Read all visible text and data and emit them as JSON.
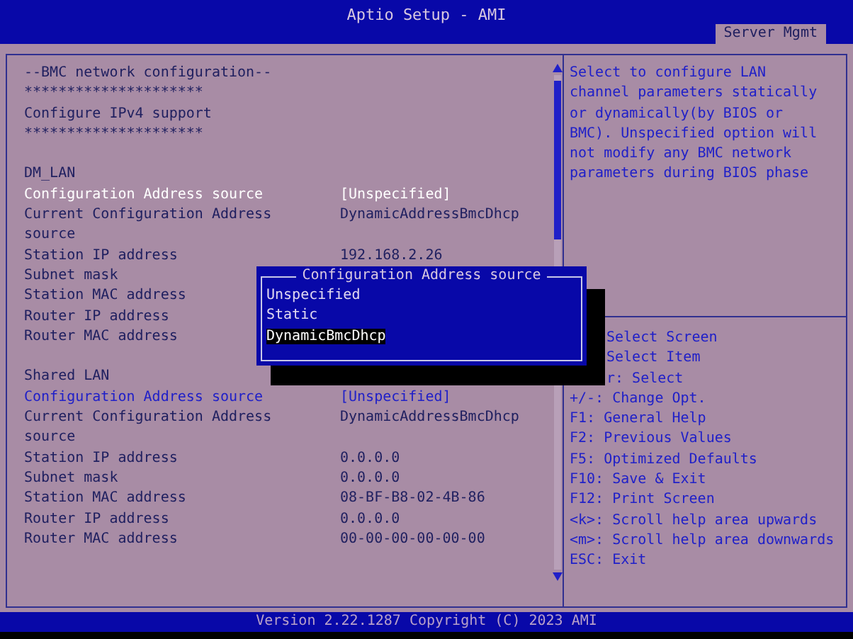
{
  "title": "Aptio Setup - AMI",
  "tabs": [
    {
      "label": "Server Mgmt",
      "selected": true
    }
  ],
  "sections": [
    {
      "rows": [
        {
          "kind": "text",
          "label": "--BMC network configuration--"
        },
        {
          "kind": "text",
          "label": "*********************"
        },
        {
          "kind": "text",
          "label": "Configure IPv4 support"
        },
        {
          "kind": "text",
          "label": "*********************"
        }
      ]
    },
    {
      "rows": [
        {
          "kind": "text",
          "label": "DM_LAN"
        },
        {
          "kind": "setting",
          "label": "Configuration Address source",
          "value": "[Unspecified]",
          "highlighted": true
        },
        {
          "kind": "info",
          "label": "Current Configuration Address source",
          "value": "DynamicAddressBmcDhcp"
        },
        {
          "kind": "info",
          "label": "Station IP address",
          "value": "192.168.2.26"
        },
        {
          "kind": "info",
          "label": "Subnet mask"
        },
        {
          "kind": "info",
          "label": "Station MAC address"
        },
        {
          "kind": "info",
          "label": "Router IP address"
        },
        {
          "kind": "info",
          "label": "Router MAC address"
        }
      ]
    },
    {
      "rows": [
        {
          "kind": "text",
          "label": "Shared LAN"
        },
        {
          "kind": "setting",
          "label": "Configuration Address source",
          "value": "[Unspecified]",
          "highlighted": false
        },
        {
          "kind": "info",
          "label": "Current Configuration Address source",
          "value": "DynamicAddressBmcDhcp"
        },
        {
          "kind": "info",
          "label": "Station IP address",
          "value": "0.0.0.0"
        },
        {
          "kind": "info",
          "label": "Subnet mask",
          "value": "0.0.0.0"
        },
        {
          "kind": "info",
          "label": "Station MAC address",
          "value": "08-BF-B8-02-4B-86"
        },
        {
          "kind": "info",
          "label": "Router IP address",
          "value": "0.0.0.0"
        },
        {
          "kind": "info",
          "label": "Router MAC address",
          "value": "00-00-00-00-00-00"
        }
      ]
    }
  ],
  "help": "Select to configure LAN channel parameters statically or dynamically(by BIOS or BMC). Unspecified option will not modify any BMC network parameters during BIOS phase",
  "keys": [
    {
      "text": "Select Screen",
      "covered": true
    },
    {
      "text": "Select Item",
      "covered": true
    },
    {
      "text": "r: Select",
      "covered": true
    },
    {
      "text": "+/-: Change Opt.",
      "covered": false
    },
    {
      "text": "F1: General Help",
      "covered": false
    },
    {
      "text": "F2: Previous Values",
      "covered": false
    },
    {
      "text": "F5: Optimized Defaults",
      "covered": false
    },
    {
      "text": "F10: Save & Exit",
      "covered": false
    },
    {
      "text": "F12: Print Screen",
      "covered": false
    },
    {
      "text": "<k>: Scroll help area upwards",
      "covered": false
    },
    {
      "text": "<m>: Scroll help area downwards",
      "covered": false
    },
    {
      "text": "ESC: Exit",
      "covered": false
    }
  ],
  "popup": {
    "title": "Configuration Address source",
    "options": [
      {
        "label": "Unspecified",
        "selected": false
      },
      {
        "label": "Static",
        "selected": false
      },
      {
        "label": "DynamicBmcDhcp",
        "selected": true
      }
    ]
  },
  "footer": "Version 2.22.1287 Copyright (C) 2023 AMI"
}
